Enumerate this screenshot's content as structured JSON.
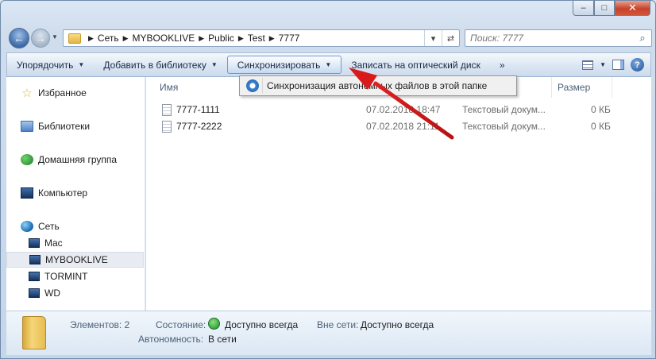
{
  "window": {
    "minimize_icon": "minimize-icon",
    "maximize_icon": "maximize-icon",
    "close_icon": "close-icon"
  },
  "address_bar": {
    "crumbs": [
      "Сеть",
      "MYBOOKLIVE",
      "Public",
      "Test",
      "7777"
    ]
  },
  "search": {
    "placeholder": "Поиск: 7777"
  },
  "toolbar": {
    "organize": "Упорядочить",
    "add_library": "Добавить в библиотеку",
    "sync": "Синхронизировать",
    "burn": "Записать на оптический диск",
    "more": "»"
  },
  "sync_menu": {
    "item": "Синхронизация автономных файлов в этой папке"
  },
  "navpane": {
    "favorites": "Избранное",
    "libraries": "Библиотеки",
    "homegroup": "Домашняя группа",
    "computer": "Компьютер",
    "network": "Сеть",
    "network_items": [
      "Mac",
      "MYBOOKLIVE",
      "TORMINT",
      "WD"
    ]
  },
  "columns": {
    "name": "Имя",
    "size": "Размер"
  },
  "files": [
    {
      "name": "7777-1111",
      "date": "07.02.2018 18:47",
      "type": "Текстовый докум...",
      "size": "0 КБ"
    },
    {
      "name": "7777-2222",
      "date": "07.02.2018 21:11",
      "type": "Текстовый докум...",
      "size": "0 КБ"
    }
  ],
  "details": {
    "count_label": "Элементов: 2",
    "status_label": "Состояние:",
    "status_value": "Доступно всегда",
    "offline_label": "Вне сети:",
    "offline_value": "Доступно всегда",
    "autonomy_label": "Автономность:",
    "autonomy_value": "В сети"
  },
  "colors": {
    "accent": "#3c6aa8",
    "annotation_arrow": "#e02020",
    "status_ok": "#1d8a2c"
  }
}
